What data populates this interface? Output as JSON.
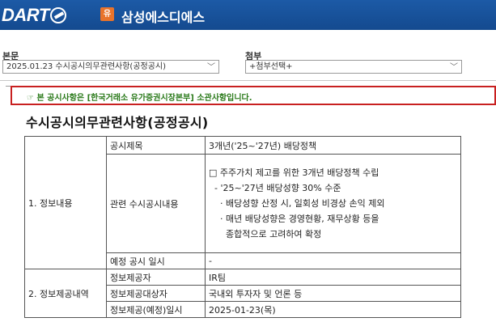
{
  "header": {
    "logo_text": "DART",
    "corp_badge": "유",
    "corp_name": "삼성에스디에스"
  },
  "selectors": {
    "main_label": "본문",
    "main_value": "2025.01.23   수시공시의무관련사항(공정공시)",
    "attach_label": "첨부",
    "attach_value": "+첨부선택+"
  },
  "notice": "☞ 본 공시사항은 [한국거래소 유가증권시장본부] 소관사항입니다.",
  "document": {
    "title": "수시공시의무관련사항(공정공시)",
    "section1": "1. 정보내용",
    "section2": "2. 정보제공내역",
    "rows": {
      "title_label": "공시제목",
      "title_value": "3개년('25~'27년) 배당정책",
      "related_label": "관련 수시공시내용",
      "related_lines": [
        "□ 주주가치 제고를 위한 3개년 배당정책 수립",
        "",
        "  - '25~'27년 배당성향 30% 수준",
        "    · 배당성향 산정 시, 일회성 비경상 손익 제외",
        "    · 매년 배당성향은 경영현황, 재무상황 등을",
        "      종합적으로 고려하여 확정"
      ],
      "planned_label": "예정 공시 일시",
      "planned_value": "-",
      "provider_label": "정보제공자",
      "provider_value": "IR팀",
      "target_label": "정보제공대상자",
      "target_value": "국내외 투자자 및 언론 등",
      "date_label": "정보제공(예정)일시",
      "date_value": "2025-01-23(목)"
    }
  }
}
